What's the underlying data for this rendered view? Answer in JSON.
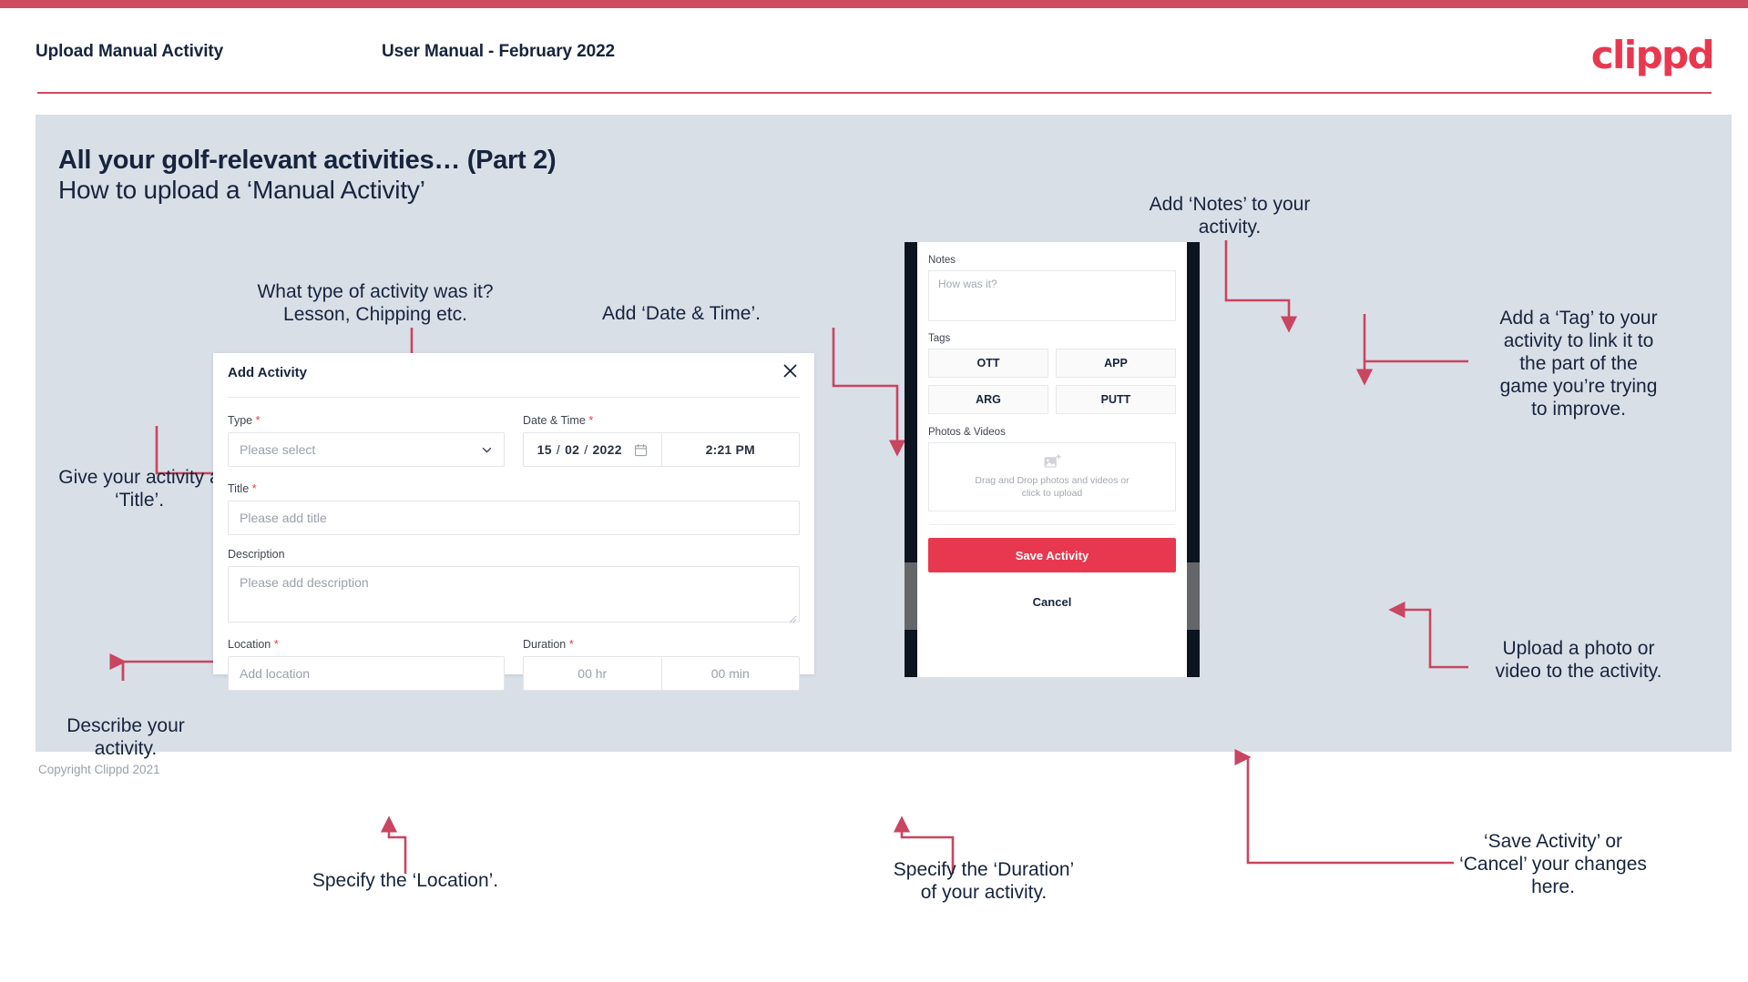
{
  "header": {
    "left_title": "Upload Manual Activity",
    "center_title": "User Manual - February 2022",
    "logo": "clippd"
  },
  "slide": {
    "title_line1": "All your golf-relevant activities… (Part 2)",
    "title_line2": "How to upload a ‘Manual Activity’"
  },
  "callouts": {
    "type": "What type of activity was it?\nLesson, Chipping etc.",
    "datetime": "Add ‘Date & Time’.",
    "title": "Give your activity a\n‘Title’.",
    "describe": "Describe your\nactivity.",
    "location": "Specify the ‘Location’.",
    "duration": "Specify the ‘Duration’\nof your activity.",
    "notes": "Add ‘Notes’ to your\nactivity.",
    "tag": "Add a ‘Tag’ to your\nactivity to link it to\nthe part of the\ngame you’re trying\nto improve.",
    "upload": "Upload a photo or\nvideo to the activity.",
    "save": "‘Save Activity’ or\n‘Cancel’ your changes\nhere."
  },
  "modal": {
    "title": "Add Activity",
    "close_icon": "close-icon",
    "fields": {
      "type_label": "Type",
      "type_placeholder": "Please select",
      "datetime_label": "Date & Time",
      "date_day": "15",
      "date_month": "02",
      "date_year": "2022",
      "date_sep": "/",
      "time_value": "2:21 PM",
      "title_label": "Title",
      "title_placeholder": "Please add title",
      "description_label": "Description",
      "description_placeholder": "Please add description",
      "location_label": "Location",
      "location_placeholder": "Add location",
      "duration_label": "Duration",
      "duration_hours": "00 hr",
      "duration_minutes": "00 min"
    },
    "required_marker": "*"
  },
  "phone": {
    "notes_label": "Notes",
    "notes_placeholder": "How was it?",
    "tags_label": "Tags",
    "tags": [
      "OTT",
      "APP",
      "ARG",
      "PUTT"
    ],
    "photos_label": "Photos & Videos",
    "drop_text": "Drag and Drop photos and videos or click to upload",
    "save_label": "Save Activity",
    "cancel_label": "Cancel"
  },
  "footer": {
    "copyright": "Copyright Clippd 2021"
  },
  "colors": {
    "brand_red": "#e8384f",
    "bar_red": "#cf4b5f",
    "annotation_red": "#c94560",
    "slide_bg": "#d9dfe7",
    "ink": "#17243d"
  }
}
